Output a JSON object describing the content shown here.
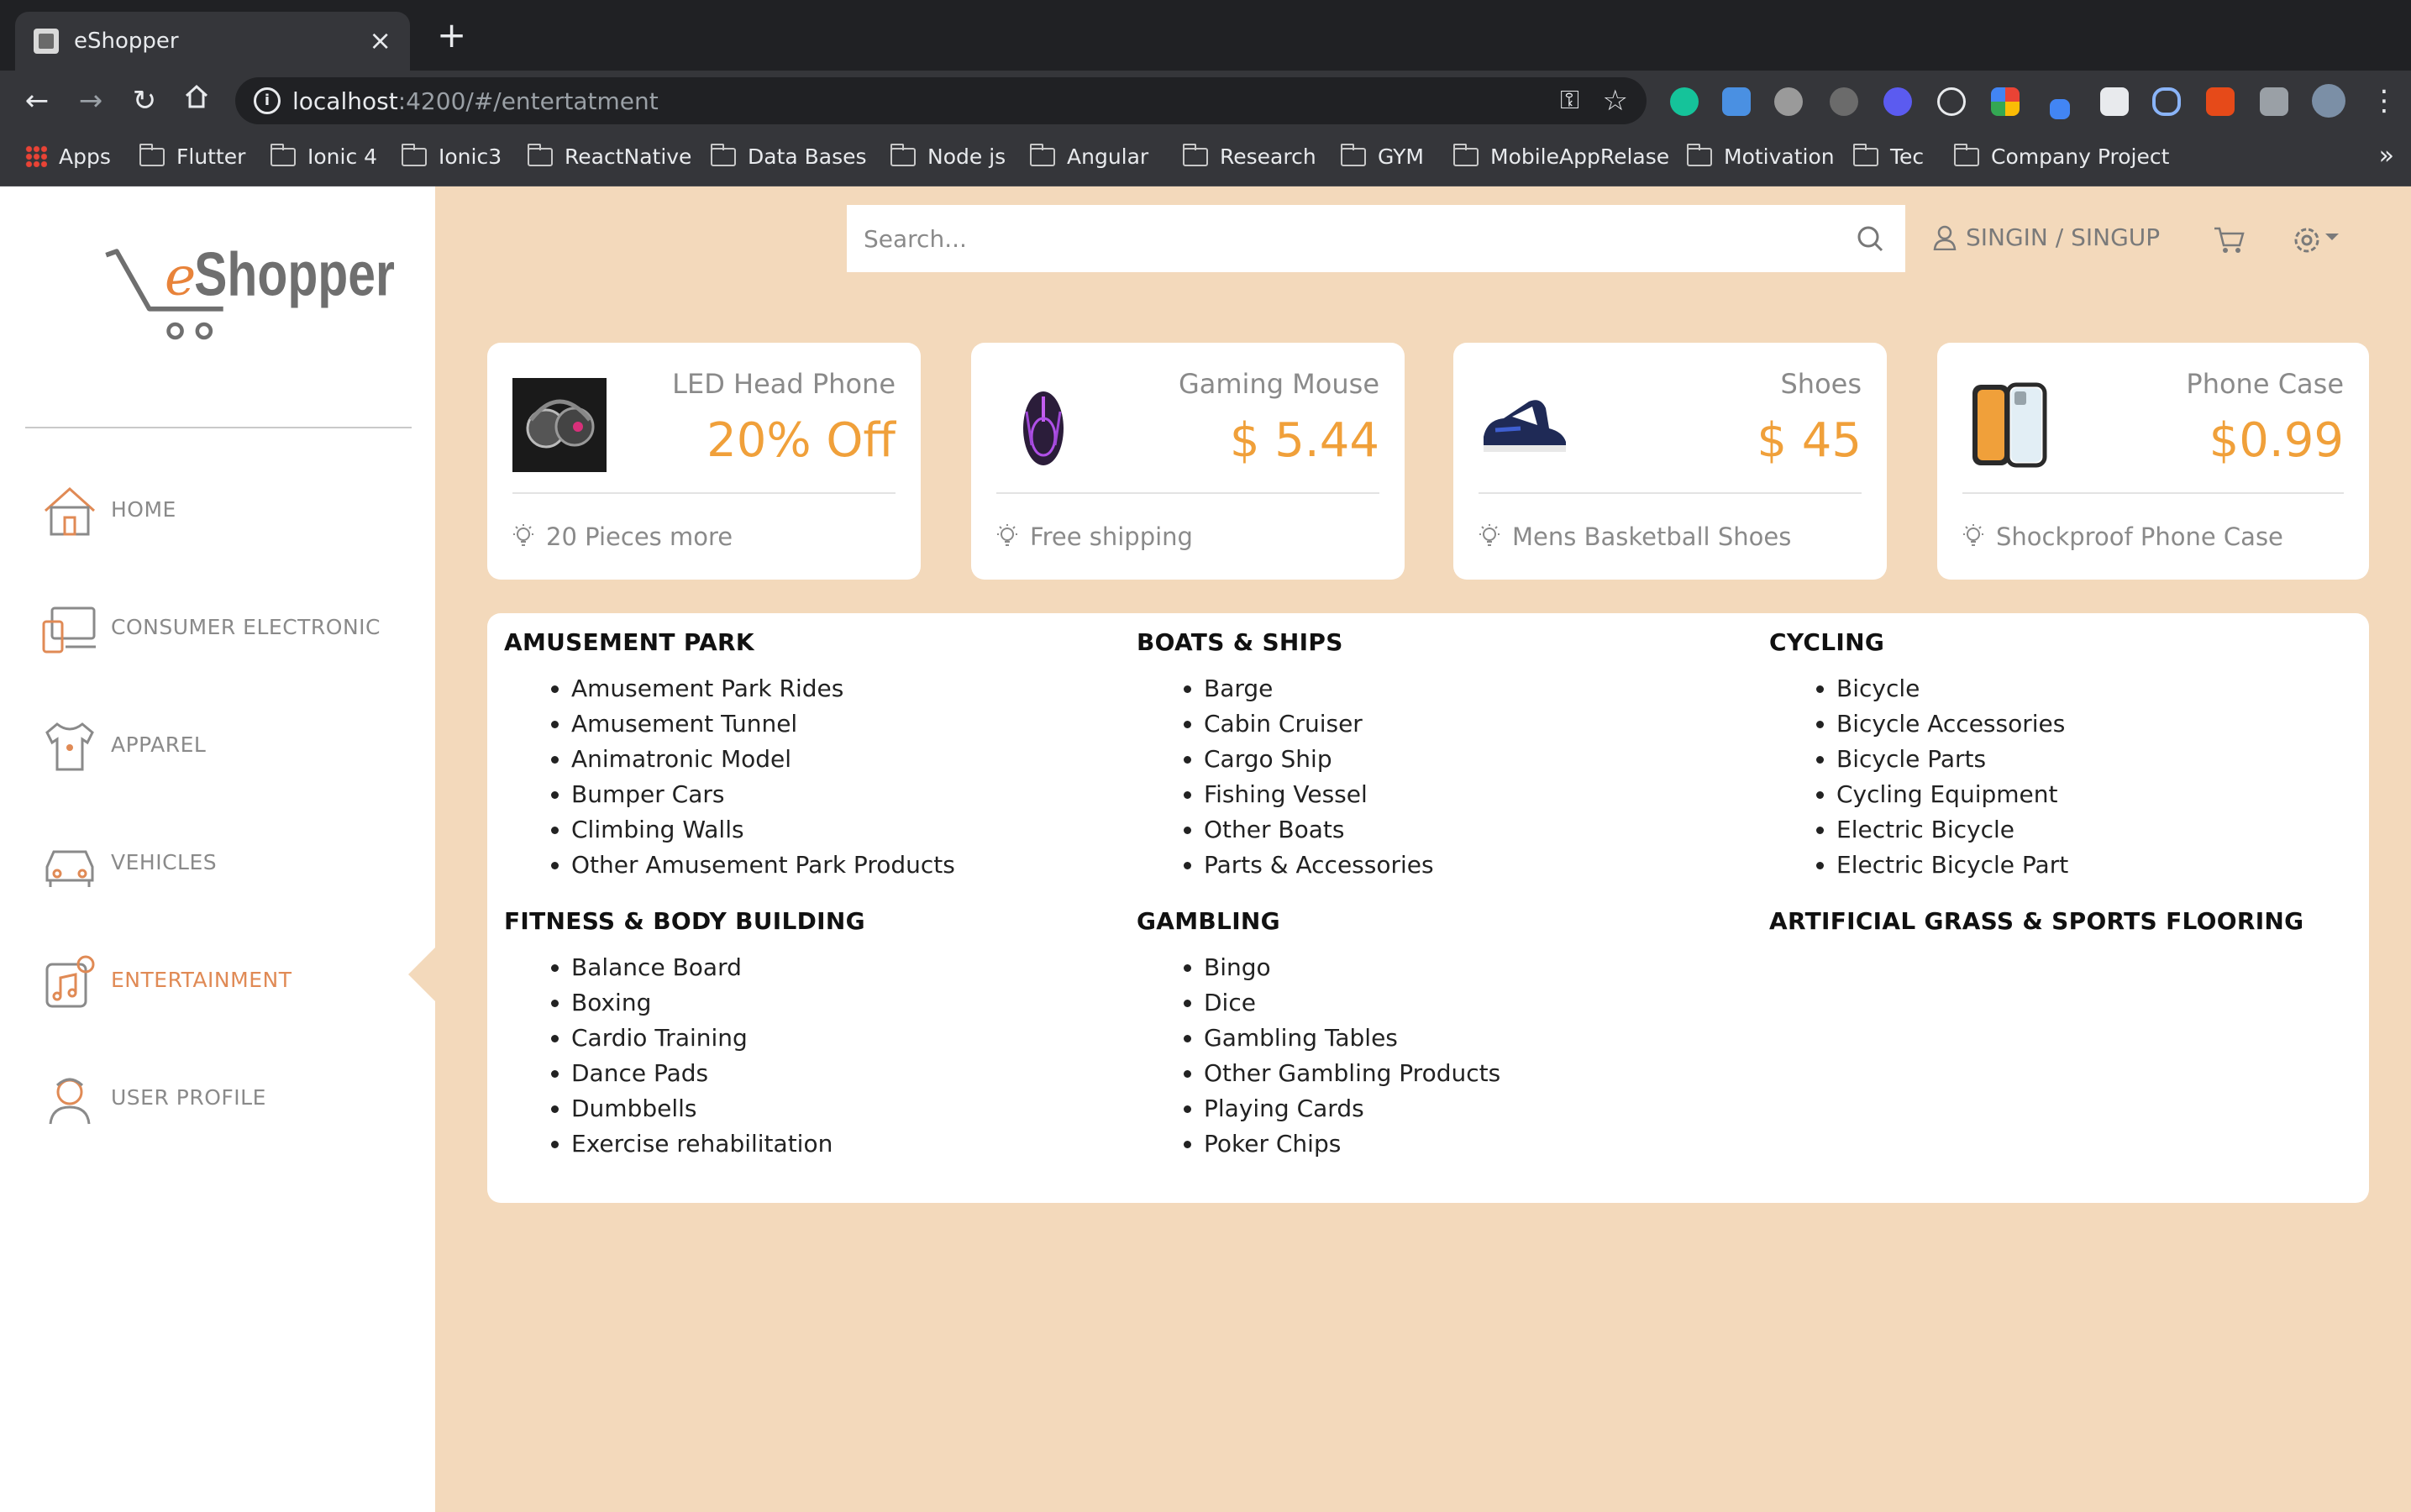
{
  "browser": {
    "tab_title": "eShopper",
    "tab_close": "×",
    "new_tab": "+",
    "url_host": "localhost",
    "url_path": ":4200/#/entertatment",
    "bookmarks": [
      "Apps",
      "Flutter",
      "Ionic 4",
      "Ionic3",
      "ReactNative",
      "Data Bases",
      "Node js",
      "Angular",
      "Research",
      "GYM",
      "MobileAppRelase",
      "Motivation",
      "Tec",
      "Company Project"
    ],
    "bookmarks_more": "»",
    "extension_icons": [
      "grammarly-icon",
      "download-icon",
      "ext-icon",
      "ublock-icon",
      "spark-icon",
      "speed-icon",
      "colors-icon",
      "pen-icon",
      "page-icon",
      "link-icon",
      "code-icon",
      "puzzle-icon",
      "profile-avatar"
    ]
  },
  "header": {
    "search_placeholder": "Search...",
    "signin_label": "SINGIN / SINGUP"
  },
  "sidebar": {
    "logo_text": "eShopper",
    "items": [
      {
        "label": "HOME",
        "icon": "home-icon"
      },
      {
        "label": "CONSUMER ELECTRONIC",
        "icon": "devices-icon"
      },
      {
        "label": "APPAREL",
        "icon": "shirt-icon"
      },
      {
        "label": "VEHICLES",
        "icon": "car-icon"
      },
      {
        "label": "ENTERTAINMENT",
        "icon": "music-icon",
        "active": true
      },
      {
        "label": "USER PROFILE",
        "icon": "user-icon"
      }
    ]
  },
  "cards": [
    {
      "title": "LED Head Phone",
      "value": "20% Off",
      "footer": "20 Pieces more"
    },
    {
      "title": "Gaming Mouse",
      "value": "$ 5.44",
      "footer": "Free shipping"
    },
    {
      "title": "Shoes",
      "value": "$ 45",
      "footer": "Mens Basketball Shoes"
    },
    {
      "title": "Phone Case",
      "value": "$0.99",
      "footer": "Shockproof Phone Case"
    }
  ],
  "categories": [
    {
      "title": "AMUSEMENT PARK",
      "items": [
        "Amusement Park Rides",
        "Amusement Tunnel",
        "Animatronic Model",
        "Bumper Cars",
        "Climbing Walls",
        "Other Amusement Park Products"
      ]
    },
    {
      "title": "BOATS & SHIPS",
      "items": [
        "Barge",
        "Cabin Cruiser",
        "Cargo Ship",
        "Fishing Vessel",
        "Other Boats",
        "Parts & Accessories"
      ]
    },
    {
      "title": "CYCLING",
      "items": [
        "Bicycle",
        "Bicycle Accessories",
        "Bicycle Parts",
        "Cycling Equipment",
        "Electric Bicycle",
        "Electric Bicycle Part"
      ]
    },
    {
      "title": "FITNESS & BODY BUILDING",
      "items": [
        "Balance Board",
        "Boxing",
        "Cardio Training",
        "Dance Pads",
        "Dumbbells",
        "Exercise rehabilitation"
      ]
    },
    {
      "title": "GAMBLING",
      "items": [
        "Bingo",
        "Dice",
        "Gambling Tables",
        "Other Gambling Products",
        "Playing Cards",
        "Poker Chips"
      ]
    },
    {
      "title": "ARTIFICIAL GRASS & SPORTS FLOORING",
      "items": []
    }
  ],
  "colors": {
    "background": "#f3d9bb",
    "accent": "#e08a55",
    "price": "#f0a03a"
  }
}
